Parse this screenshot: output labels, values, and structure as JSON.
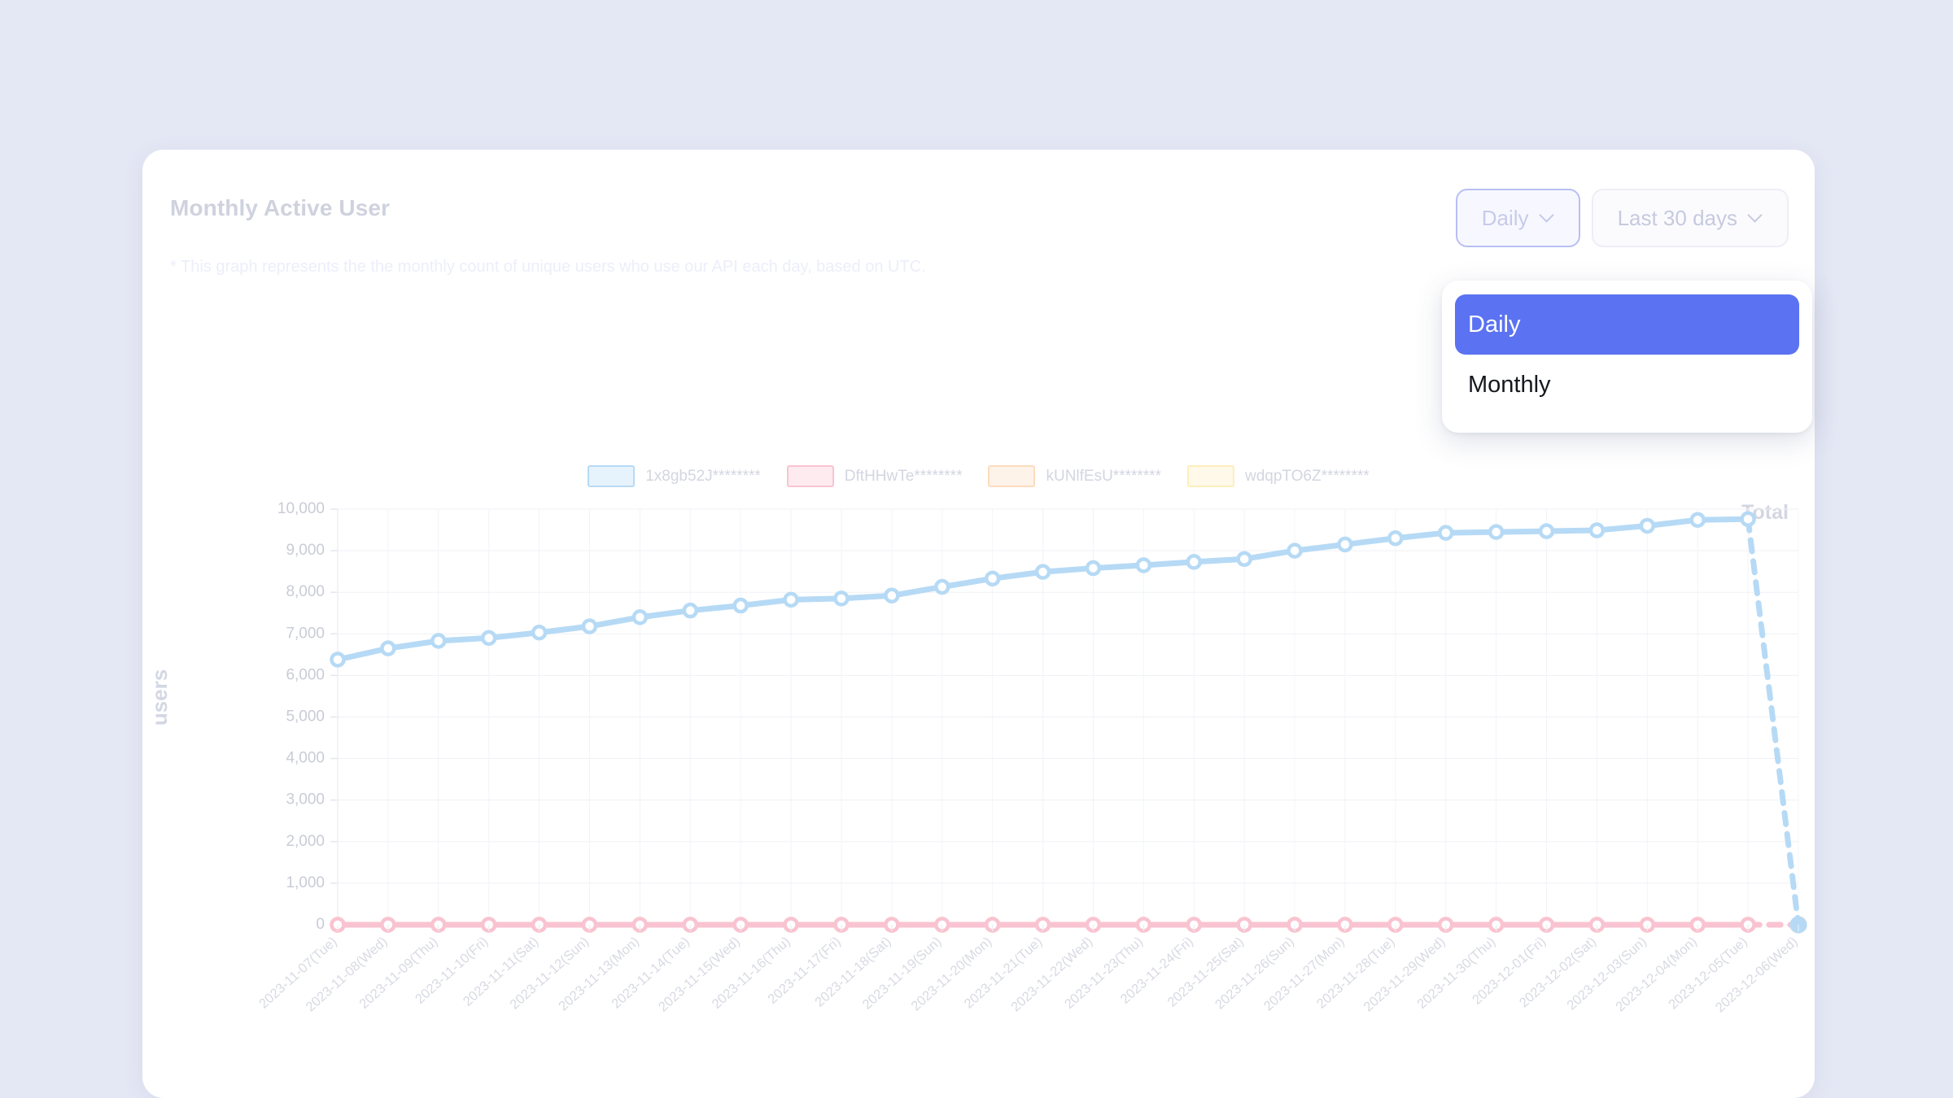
{
  "card": {
    "title": "Monthly Active User",
    "description": "* This graph represents the the monthly count of unique users who use our API each day, based on UTC.",
    "total_label": "Total"
  },
  "controls": {
    "granularity": {
      "selected": "Daily",
      "chevron_icon": "chevron-down-icon",
      "options": [
        "Daily",
        "Monthly"
      ]
    },
    "range": {
      "selected": "Last 30 days",
      "chevron_icon": "chevron-down-icon"
    }
  },
  "dropdown": {
    "open": true,
    "items": [
      {
        "label": "Daily",
        "selected": true
      },
      {
        "label": "Monthly",
        "selected": false
      }
    ]
  },
  "colors": {
    "accent": "#5b72f2",
    "series_blue": "#b6daf5",
    "series_pink": "#f9c3d1",
    "series_orange": "#fcdcbd",
    "series_yellow": "#fdeebc",
    "page_background": "#e4e7f4",
    "card_background": "#ffffff"
  },
  "chart_data": {
    "type": "line",
    "title": "Monthly Active User",
    "xlabel": "",
    "ylabel": "users",
    "ylim": [
      0,
      10000
    ],
    "yticks": [
      "0",
      "1,000",
      "2,000",
      "3,000",
      "4,000",
      "5,000",
      "6,000",
      "7,000",
      "8,000",
      "9,000",
      "10,000"
    ],
    "grid": true,
    "legend_position": "top-center",
    "categories": [
      "2023-11-07(Tue)",
      "2023-11-08(Wed)",
      "2023-11-09(Thu)",
      "2023-11-10(Fri)",
      "2023-11-11(Sat)",
      "2023-11-12(Sun)",
      "2023-11-13(Mon)",
      "2023-11-14(Tue)",
      "2023-11-15(Wed)",
      "2023-11-16(Thu)",
      "2023-11-17(Fri)",
      "2023-11-18(Sat)",
      "2023-11-19(Sun)",
      "2023-11-20(Mon)",
      "2023-11-21(Tue)",
      "2023-11-22(Wed)",
      "2023-11-23(Thu)",
      "2023-11-24(Fri)",
      "2023-11-25(Sat)",
      "2023-11-26(Sun)",
      "2023-11-27(Mon)",
      "2023-11-28(Tue)",
      "2023-11-29(Wed)",
      "2023-11-30(Thu)",
      "2023-12-01(Fri)",
      "2023-12-02(Sat)",
      "2023-12-03(Sun)",
      "2023-12-04(Mon)",
      "2023-12-05(Tue)",
      "2023-12-06(Wed)"
    ],
    "series": [
      {
        "name": "1x8gb52J********",
        "color": "#b6daf5",
        "dashed_last_segment": true,
        "values": [
          6380,
          6650,
          6830,
          6900,
          7030,
          7180,
          7400,
          7560,
          7680,
          7820,
          7850,
          7920,
          8130,
          8330,
          8490,
          8580,
          8650,
          8730,
          8800,
          9000,
          9150,
          9300,
          9430,
          9450,
          9470,
          9490,
          9600,
          9740,
          9760,
          0
        ]
      },
      {
        "name": "DftHHwTe********",
        "color": "#f9c3d1",
        "dashed_last_segment": true,
        "values": [
          0,
          0,
          0,
          0,
          0,
          0,
          0,
          0,
          0,
          0,
          0,
          0,
          0,
          0,
          0,
          0,
          0,
          0,
          0,
          0,
          0,
          0,
          0,
          0,
          0,
          0,
          0,
          0,
          0,
          0
        ]
      },
      {
        "name": "kUNlfEsU********",
        "color": "#fcdcbd",
        "dashed_last_segment": true,
        "values": [
          0,
          0,
          0,
          0,
          0,
          0,
          0,
          0,
          0,
          0,
          0,
          0,
          0,
          0,
          0,
          0,
          0,
          0,
          0,
          0,
          0,
          0,
          0,
          0,
          0,
          0,
          0,
          0,
          0,
          0
        ]
      },
      {
        "name": "wdqpTO6Z********",
        "color": "#fdeebc",
        "dashed_last_segment": true,
        "values": [
          0,
          0,
          0,
          0,
          0,
          0,
          0,
          0,
          0,
          0,
          0,
          0,
          0,
          0,
          0,
          0,
          0,
          0,
          0,
          0,
          0,
          0,
          0,
          0,
          0,
          0,
          0,
          0,
          0,
          0
        ]
      }
    ]
  }
}
